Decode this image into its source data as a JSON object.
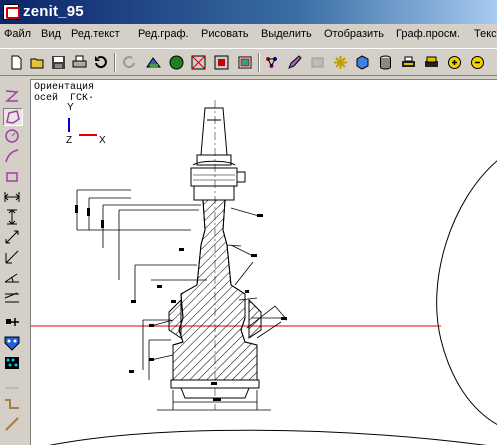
{
  "window": {
    "title": "zenit_95"
  },
  "menu": {
    "items": [
      "Файл",
      "Вид",
      "Ред.текст",
      "Ред.граф.",
      "Рисовать",
      "Выделить",
      "Отобразить",
      "Граф.просм.",
      "Текст"
    ]
  },
  "toolbar": {
    "buttons": [
      "new-icon",
      "open-icon",
      "save-icon",
      "print-icon",
      "undo-icon",
      "redo-icon",
      "view-3d-icon",
      "sphere-icon",
      "grid-frame-icon",
      "grid-frame-red-icon",
      "layers-icon",
      "network-icon",
      "edit-pen-icon",
      "blank-icon",
      "star-cursor-icon",
      "box-cube-icon",
      "cylinder-icon",
      "printer-color-icon",
      "printer-yellow-icon",
      "zoom-in-icon",
      "zoom-out-icon"
    ]
  },
  "lefttools": {
    "buttons": [
      "zigzag-icon",
      "polygon-icon",
      "circle-icon",
      "arc-icon",
      "rectangle-icon",
      "horizontal-dimension-icon",
      "vertical-dimension-icon",
      "diagonal-dimension-icon",
      "corner-dimension-icon",
      "angle-icon",
      "equal-angle-icon",
      "plus-point-icon",
      "fill-pattern-icon",
      "dot-pattern-icon",
      "line-tool-icon",
      "step-icon",
      "slash-icon"
    ]
  },
  "canvas": {
    "orientation_label": "Ориентация\nосей  ГСК·",
    "axis_y": "Y",
    "axis_z": "Z",
    "axis_x": "X"
  },
  "colors": {
    "title_start": "#0a246a",
    "title_end": "#a6caf0",
    "x_axis": "#e00000",
    "y_axis": "#0000cc",
    "guide_line": "#e00000"
  }
}
